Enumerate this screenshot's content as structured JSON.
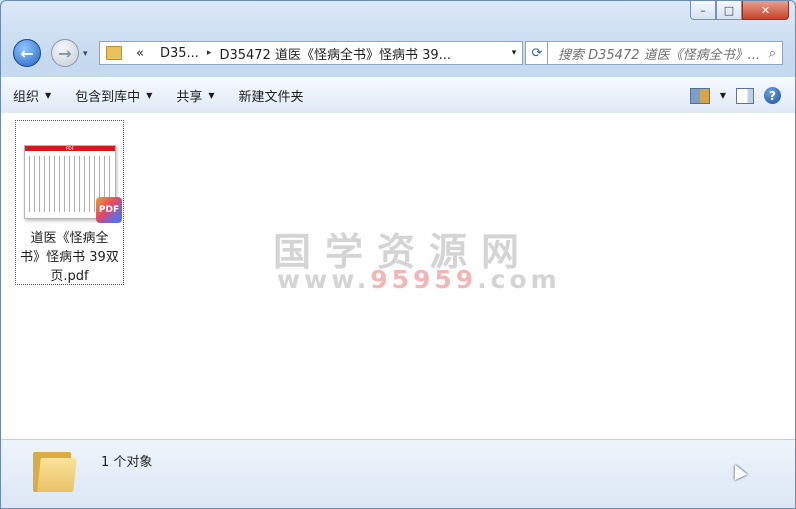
{
  "window": {
    "caption": {
      "minimize": "–",
      "maximize": "□",
      "close": "✕"
    }
  },
  "nav": {
    "back_glyph": "←",
    "forward_glyph": "→",
    "history_glyph": "▾",
    "address": {
      "prefix": "«",
      "segments": [
        "D35...",
        "D35472 道医《怪病全书》怪病书 39..."
      ],
      "separator": "▸",
      "dropdown_glyph": "▾"
    },
    "refresh_glyph": "⟳",
    "search_placeholder": "搜索 D35472 道医《怪病全书》...",
    "search_glyph": "⌕"
  },
  "toolbar": {
    "organize": "组织",
    "include_library": "包含到库中",
    "share": "共享",
    "new_folder": "新建文件夹",
    "dropdown_glyph": "▼",
    "help_glyph": "?"
  },
  "files": [
    {
      "name_lines": [
        "道医《怪病全",
        "书》怪病书 39双",
        "页.pdf"
      ],
      "thumb_header": "PDF",
      "badge": "PDF"
    }
  ],
  "watermark": {
    "line1": "国学资源网",
    "line2_prefix": "www.",
    "line2_number": "95959",
    "line2_suffix": ".com"
  },
  "status": {
    "count_text": "1 个对象"
  },
  "colors": {
    "accent": "#2565c4",
    "watermark_red": "#f0b7b7",
    "close_button": "#c7432a"
  }
}
